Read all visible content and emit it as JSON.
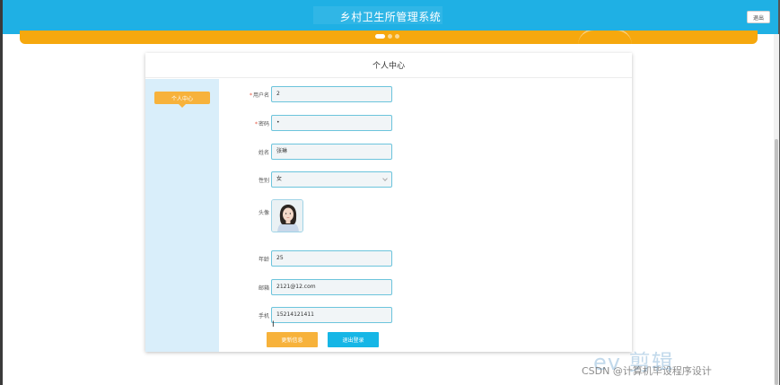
{
  "header": {
    "title": "乡村卫生所管理系统",
    "logout_label": "退出"
  },
  "banner": {
    "active_slide": 1,
    "slide_count": 3
  },
  "card": {
    "title": "个人中心",
    "side_tab": "个人中心"
  },
  "form": {
    "username": {
      "label": "用户名",
      "value": "2",
      "required": true
    },
    "password": {
      "label": "密码",
      "value": "•",
      "required": true
    },
    "name": {
      "label": "姓名",
      "value": "张琳"
    },
    "gender": {
      "label": "性别",
      "value": "女"
    },
    "avatar": {
      "label": "头像"
    },
    "age": {
      "label": "年龄",
      "value": "25"
    },
    "email": {
      "label": "邮箱",
      "value": "2121@12.com"
    },
    "phone": {
      "label": "手机",
      "value": "15214121411"
    }
  },
  "buttons": {
    "update": "更新信息",
    "logout": "退出登录"
  },
  "watermark": {
    "logo": "ev 剪辑",
    "text": "CSDN @计算机毕设程序设计"
  },
  "colors": {
    "header": "#1fb0e4",
    "banner": "#f6a80e",
    "accent_orange": "#f7b23b",
    "accent_blue": "#16b6e6",
    "sidebar": "#d9eefa"
  }
}
